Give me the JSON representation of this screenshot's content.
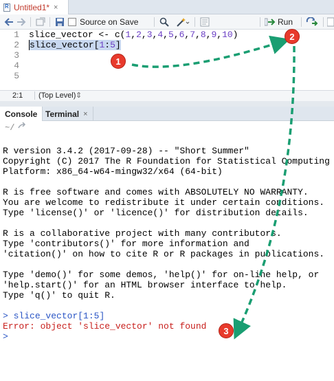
{
  "editor_tab": {
    "label": "Untitled1*",
    "icon": "r-file-icon",
    "close_icon": "close-icon"
  },
  "toolbar": {
    "source_on_save_label": "Source on Save",
    "run_label": "Run",
    "icons": [
      "back-arrow-icon",
      "forward-arrow-icon",
      "show-in-window-icon",
      "save-icon",
      "search-icon",
      "magic-wand-icon",
      "outline-icon",
      "run-arrow-icon",
      "rerun-icon",
      "source-icon"
    ]
  },
  "editor": {
    "line_numbers": [
      "1",
      "2",
      "3",
      "4",
      "5"
    ],
    "line1": {
      "prefix": "slice_vector <- c(",
      "numbers": [
        "1",
        "2",
        "3",
        "4",
        "5",
        "6",
        "7",
        "8",
        "9",
        "10"
      ],
      "suffix": ")"
    },
    "line2": {
      "ident": "slice_vector",
      "open": "[",
      "a": "1",
      "colon": ":",
      "b": "5",
      "close": "]"
    }
  },
  "statusbar": {
    "position": "2:1",
    "scope": "(Top Level)"
  },
  "console_tabs": {
    "console": "Console",
    "terminal": "Terminal",
    "terminal_close": "×"
  },
  "console_path": "~/",
  "console_lines": [
    "R version 3.4.2 (2017-09-28) -- \"Short Summer\"",
    "Copyright (C) 2017 The R Foundation for Statistical Computing",
    "Platform: x86_64-w64-mingw32/x64 (64-bit)",
    "",
    "R is free software and comes with ABSOLUTELY NO WARRANTY.",
    "You are welcome to redistribute it under certain conditions.",
    "Type 'license()' or 'licence()' for distribution details.",
    "",
    "R is a collaborative project with many contributors.",
    "Type 'contributors()' for more information and",
    "'citation()' on how to cite R or R packages in publications.",
    "",
    "Type 'demo()' for some demos, 'help()' for on-line help, or",
    "'help.start()' for an HTML browser interface to help.",
    "Type 'q()' to quit R."
  ],
  "console_input": {
    "prompt": ">",
    "command": "slice_vector[1:5]"
  },
  "console_error": "Error: object 'slice_vector' not found",
  "console_final_prompt": ">",
  "annotations": [
    "1",
    "2",
    "3"
  ],
  "colors": {
    "accent_red": "#e83a2c",
    "arrow_green": "#1a9e72",
    "selection": "#c8d8f0",
    "error": "#c8201d",
    "prompt": "#2a55c5"
  }
}
